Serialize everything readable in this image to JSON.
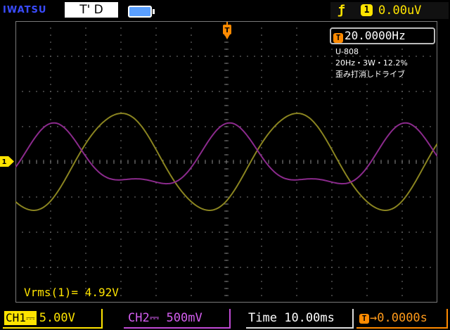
{
  "header": {
    "brand": "IWATSU",
    "trigger_state": "T' D",
    "trigger_source": "1",
    "trigger_level": "0.00uV",
    "trigger_edge_icon": "rising-edge-icon",
    "battery_icon": "battery-icon"
  },
  "measure": {
    "frequency": "20.0000Hz",
    "vrms": "Vrms(1)= 4.92V"
  },
  "notes": [
    "U-808",
    "20Hz・3W・12.2%",
    "歪み打消しドライブ"
  ],
  "channels": {
    "ch1": {
      "label": "CH1",
      "coupling_icon": "dc-coupling-icon",
      "scale": "5.00V",
      "color": "#ffe400"
    },
    "ch2": {
      "label": "CH2",
      "coupling_icon": "dc-coupling-icon",
      "scale": "500mV",
      "color": "#c14ad6"
    }
  },
  "timebase": {
    "label": "Time",
    "value": "10.00ms",
    "offset": "0.0000s",
    "offset_color": "#ff8a00"
  },
  "colors": {
    "trace1": "#8a8420",
    "trace2": "#8b2a8c",
    "grid": "#7a7a7a"
  },
  "markers": {
    "ch1_marker": "1",
    "trigger_marker": "T"
  }
}
